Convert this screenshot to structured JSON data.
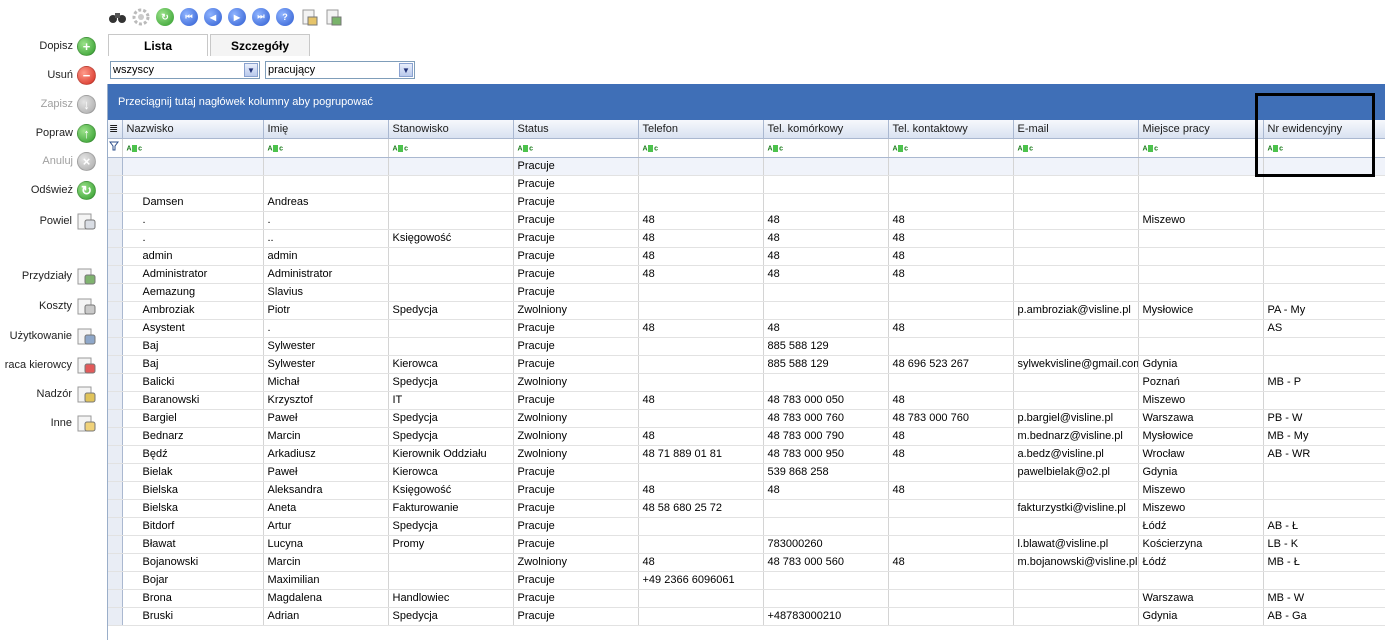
{
  "sidebar": {
    "items": [
      {
        "label": "Dopisz",
        "icon": "plus-icon",
        "enabled": true
      },
      {
        "label": "Usuń",
        "icon": "minus-icon",
        "enabled": true
      },
      {
        "label": "Zapisz",
        "icon": "save-icon",
        "enabled": false
      },
      {
        "label": "Popraw",
        "icon": "edit-up-icon",
        "enabled": true
      },
      {
        "label": "Anuluj",
        "icon": "cancel-icon",
        "enabled": false
      },
      {
        "label": "Odśwież",
        "icon": "refresh-icon",
        "enabled": true
      },
      {
        "label": "Powiel",
        "icon": "duplicate-icon",
        "enabled": true
      },
      {
        "label": "Przydziały",
        "icon": "assignments-icon",
        "enabled": true
      },
      {
        "label": "Koszty",
        "icon": "costs-icon",
        "enabled": true
      },
      {
        "label": "Użytkowanie",
        "icon": "usage-icon",
        "enabled": true
      },
      {
        "label": "raca kierowcy",
        "icon": "driver-work-icon",
        "enabled": true
      },
      {
        "label": "Nadzór",
        "icon": "supervision-icon",
        "enabled": true
      },
      {
        "label": "Inne",
        "icon": "pencil-icon",
        "enabled": true
      }
    ]
  },
  "toolbar": {
    "icons": [
      "binoculars-icon",
      "settings-icon",
      "refresh-icon",
      "first-icon",
      "prev-icon",
      "next-icon",
      "last-icon",
      "help-icon",
      "report-icon",
      "export-icon"
    ]
  },
  "tabs": [
    {
      "label": "Lista",
      "active": true
    },
    {
      "label": "Szczegóły",
      "active": false
    }
  ],
  "filters": {
    "scope": "wszyscy",
    "status": "pracujący"
  },
  "grid": {
    "group_hint": "Przeciągnij tutaj nagłówek kolumny aby pogrupować",
    "columns": [
      "Nazwisko",
      "Imię",
      "Stanowisko",
      "Status",
      "Telefon",
      "Tel. komórkowy",
      "Tel. kontaktowy",
      "E-mail",
      "Miejsce pracy",
      "Nr ewidencyjny"
    ],
    "filter_icon_label": "ABC",
    "rows": [
      [
        "",
        "",
        "",
        "Pracuje",
        "",
        "",
        "",
        "",
        "",
        ""
      ],
      [
        "",
        "",
        "",
        "Pracuje",
        "",
        "",
        "",
        "",
        "",
        ""
      ],
      [
        "Damsen",
        "Andreas",
        "",
        "Pracuje",
        "",
        "",
        "",
        "",
        "",
        ""
      ],
      [
        ".",
        ".",
        "",
        "Pracuje",
        "48",
        "48",
        "48",
        "",
        "Miszewo",
        ""
      ],
      [
        ".",
        "..",
        "Księgowość",
        "Pracuje",
        "48",
        "48",
        "48",
        "",
        "",
        ""
      ],
      [
        "admin",
        "admin",
        "",
        "Pracuje",
        "48",
        "48",
        "48",
        "",
        "",
        ""
      ],
      [
        "Administrator",
        "Administrator",
        "",
        "Pracuje",
        "48",
        "48",
        "48",
        "",
        "",
        ""
      ],
      [
        "Aemazung",
        "Slavius",
        "",
        "Pracuje",
        "",
        "",
        "",
        "",
        "",
        ""
      ],
      [
        "Ambroziak",
        "Piotr",
        "Spedycja",
        "Zwolniony",
        "",
        "",
        "",
        "p.ambroziak@visline.pl",
        "Mysłowice",
        "PA - My"
      ],
      [
        "Asystent",
        ".",
        "",
        "Pracuje",
        "48",
        "48",
        "48",
        "",
        "",
        "AS"
      ],
      [
        "Baj",
        "Sylwester",
        "",
        "Pracuje",
        "",
        "885 588 129",
        "",
        "",
        "",
        ""
      ],
      [
        "Baj",
        "Sylwester",
        "Kierowca",
        "Pracuje",
        "",
        "885 588 129",
        "48 696 523 267",
        "sylwekvisline@gmail.com",
        "Gdynia",
        ""
      ],
      [
        "Balicki",
        "Michał",
        "Spedycja",
        "Zwolniony",
        "",
        "",
        "",
        "",
        "Poznań",
        "MB - P"
      ],
      [
        "Baranowski",
        "Krzysztof",
        "IT",
        "Pracuje",
        "48",
        "48 783 000 050",
        "48",
        "",
        "Miszewo",
        ""
      ],
      [
        "Bargiel",
        "Paweł",
        "Spedycja",
        "Zwolniony",
        "",
        "48 783 000 760",
        "48 783 000 760",
        "p.bargiel@visline.pl",
        "Warszawa",
        "PB - W"
      ],
      [
        "Bednarz",
        "Marcin",
        "Spedycja",
        "Zwolniony",
        "48",
        "48 783 000 790",
        "48",
        "m.bednarz@visline.pl",
        "Mysłowice",
        "MB - My"
      ],
      [
        "Będź",
        "Arkadiusz",
        "Kierownik Oddziału",
        "Zwolniony",
        "48 71 889 01 81",
        "48 783 000 950",
        "48",
        "a.bedz@visline.pl",
        "Wrocław",
        "AB - WR"
      ],
      [
        "Bielak",
        "Paweł",
        "Kierowca",
        "Pracuje",
        "",
        "539 868 258",
        "",
        "pawelbielak@o2.pl",
        "Gdynia",
        ""
      ],
      [
        "Bielska",
        "Aleksandra",
        "Księgowość",
        "Pracuje",
        "48",
        "48",
        "48",
        "",
        "Miszewo",
        ""
      ],
      [
        "Bielska",
        "Aneta",
        "Fakturowanie",
        "Pracuje",
        "48 58 680 25 72",
        "",
        "",
        "fakturzystki@visline.pl",
        "Miszewo",
        ""
      ],
      [
        "Bitdorf",
        "Artur",
        "Spedycja",
        "Pracuje",
        "",
        "",
        "",
        "",
        "Łódź",
        "AB - Ł"
      ],
      [
        "Bławat",
        "Lucyna",
        "Promy",
        "Pracuje",
        "",
        "783000260",
        "",
        "l.blawat@visline.pl",
        "Kościerzyna",
        "LB - K"
      ],
      [
        "Bojanowski",
        "Marcin",
        "",
        "Zwolniony",
        "48",
        "48 783 000 560",
        "48",
        "m.bojanowski@visline.pl",
        "Łódź",
        "MB - Ł"
      ],
      [
        "Bojar",
        "Maximilian",
        "",
        "Pracuje",
        "+49 2366 6096061",
        "",
        "",
        "",
        "",
        ""
      ],
      [
        "Brona",
        "Magdalena",
        "Handlowiec",
        "Pracuje",
        "",
        "",
        "",
        "",
        "Warszawa",
        "MB - W"
      ],
      [
        "Bruski",
        "Adrian",
        "Spedycja",
        "Pracuje",
        "",
        "+48783000210",
        "",
        "",
        "Gdynia",
        "AB - Ga"
      ]
    ]
  }
}
